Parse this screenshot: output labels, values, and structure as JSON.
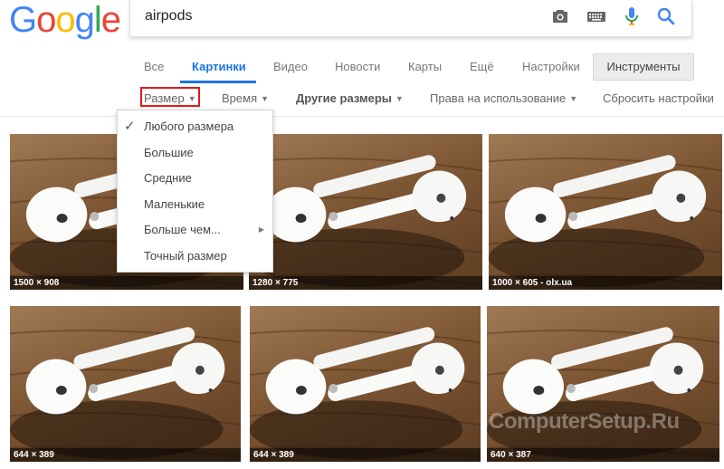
{
  "logo": {
    "letters": [
      "G",
      "o",
      "o",
      "g",
      "l",
      "e"
    ],
    "colors": [
      "#4285F4",
      "#EA4335",
      "#FBBC05",
      "#4285F4",
      "#34A853",
      "#EA4335"
    ]
  },
  "search": {
    "query": "airpods",
    "icons": [
      "camera-icon",
      "keyboard-icon",
      "microphone-icon",
      "search-icon"
    ]
  },
  "tabs": [
    {
      "label": "Все",
      "active": false
    },
    {
      "label": "Картинки",
      "active": true
    },
    {
      "label": "Видео",
      "active": false
    },
    {
      "label": "Новости",
      "active": false
    },
    {
      "label": "Карты",
      "active": false
    },
    {
      "label": "Ещё",
      "active": false
    },
    {
      "label": "Настройки",
      "active": false
    }
  ],
  "tools_button": "Инструменты",
  "tools": [
    {
      "label": "Размер",
      "caret": true,
      "bold": false
    },
    {
      "label": "Время",
      "caret": true,
      "bold": false
    },
    {
      "label": "Другие размеры",
      "caret": true,
      "bold": true
    },
    {
      "label": "Права на использование",
      "caret": true,
      "bold": false
    },
    {
      "label": "Сбросить настройки",
      "caret": false,
      "bold": false
    }
  ],
  "size_menu": {
    "items": [
      {
        "label": "Любого размера",
        "checked": true,
        "submenu": false
      },
      {
        "label": "Большие",
        "checked": false,
        "submenu": false
      },
      {
        "label": "Средние",
        "checked": false,
        "submenu": false
      },
      {
        "label": "Маленькие",
        "checked": false,
        "submenu": false
      },
      {
        "label": "Больше чем...",
        "checked": false,
        "submenu": true
      },
      {
        "label": "Точный размер",
        "checked": false,
        "submenu": false
      }
    ]
  },
  "results": [
    {
      "caption": "1500 × 908"
    },
    {
      "caption": "1280 × 775"
    },
    {
      "caption": "1000 × 605 - olx.ua"
    },
    {
      "caption": "644 × 389"
    },
    {
      "caption": "644 × 389"
    },
    {
      "caption": "640 × 387"
    }
  ],
  "watermark": "ComputerSetup.Ru",
  "colors": {
    "accent": "#1a73e8",
    "highlight_border": "#e01a1a"
  }
}
